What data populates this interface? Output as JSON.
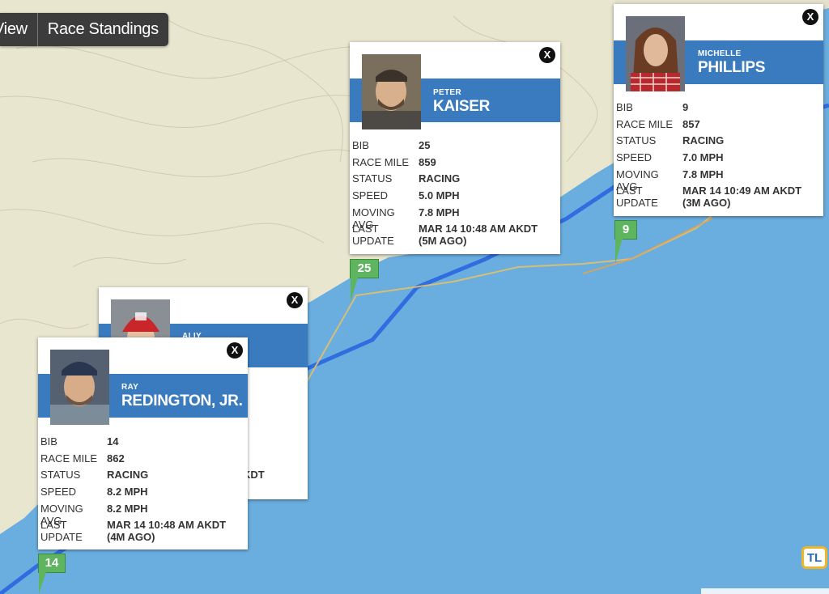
{
  "toolbar": {
    "view_label": "View",
    "standings_label": "Race Standings"
  },
  "field_labels": {
    "bib": "BIB",
    "race_mile": "RACE MILE",
    "status": "STATUS",
    "speed": "SPEED",
    "moving_avg": "MOVING AVG",
    "last_update": "LAST UPDATE"
  },
  "close_glyph": "X",
  "mushers": {
    "kaiser": {
      "first": "PETER",
      "last": "KAISER",
      "bib": "25",
      "race_mile": "859",
      "status": "RACING",
      "speed": "5.0 MPH",
      "moving_avg": "7.8 MPH",
      "last_update": "MAR 14 10:48 AM AKDT",
      "ago": "(5M AGO)",
      "marker": "25"
    },
    "phillips": {
      "first": "MICHELLE",
      "last": "PHILLIPS",
      "bib": "9",
      "race_mile": "857",
      "status": "RACING",
      "speed": "7.0 MPH",
      "moving_avg": "7.8 MPH",
      "last_update": "MAR 14 10:49 AM AKDT",
      "ago": "(3M AGO)",
      "marker": "9"
    },
    "aliy": {
      "first": "ALIY",
      "partial_update": "KDT"
    },
    "redington": {
      "first": "RAY",
      "last": "REDINGTON, JR.",
      "bib": "14",
      "race_mile": "862",
      "status": "RACING",
      "speed": "8.2 MPH",
      "moving_avg": "8.2 MPH",
      "last_update": "MAR 14 10:48 AM AKDT",
      "ago": "(4M AGO)",
      "marker": "14"
    }
  },
  "logo": {
    "text": "TL"
  },
  "colors": {
    "accent": "#3a7bbf",
    "marker": "#5fb55f",
    "water": "#6aaee0",
    "land": "#e9e8d6"
  }
}
